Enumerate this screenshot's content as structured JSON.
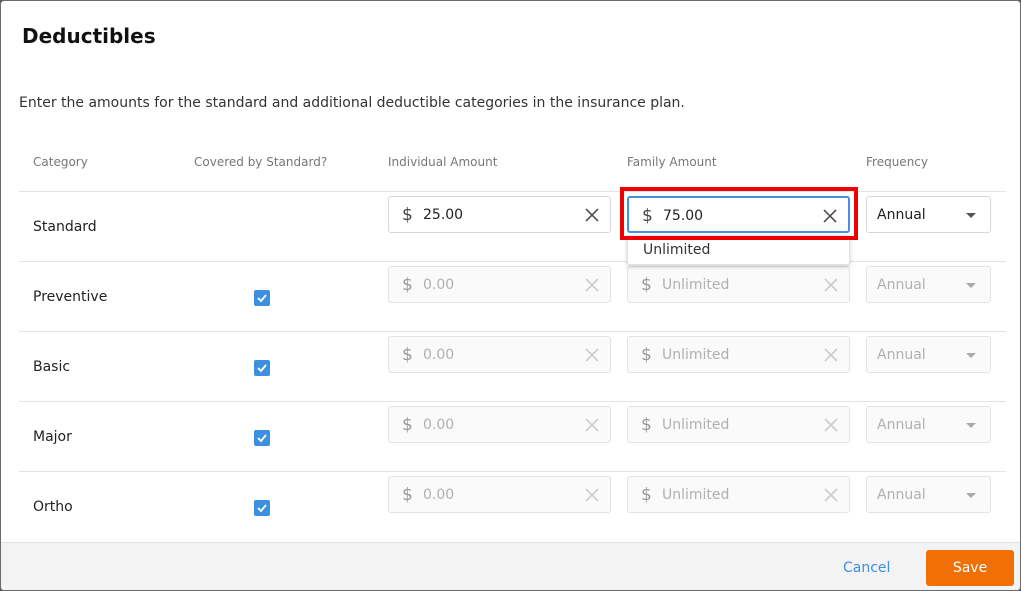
{
  "dialog": {
    "title": "Deductibles",
    "description": "Enter the amounts for the standard and additional deductible categories in the insurance plan."
  },
  "columns": {
    "category": "Category",
    "covered": "Covered by Standard?",
    "individual": "Individual Amount",
    "family": "Family Amount",
    "frequency": "Frequency"
  },
  "currency_symbol": "$",
  "rows": [
    {
      "category": "Standard",
      "covered": false,
      "individual": "25.00",
      "family": "75.00",
      "frequency": "Annual",
      "disabled": false
    },
    {
      "category": "Preventive",
      "covered": true,
      "individual": "0.00",
      "family": "Unlimited",
      "frequency": "Annual",
      "disabled": true
    },
    {
      "category": "Basic",
      "covered": true,
      "individual": "0.00",
      "family": "Unlimited",
      "frequency": "Annual",
      "disabled": true
    },
    {
      "category": "Major",
      "covered": true,
      "individual": "0.00",
      "family": "Unlimited",
      "frequency": "Annual",
      "disabled": true
    },
    {
      "category": "Ortho",
      "covered": true,
      "individual": "0.00",
      "family": "Unlimited",
      "frequency": "Annual",
      "disabled": true
    }
  ],
  "family_dropdown": {
    "option": "Unlimited"
  },
  "footer": {
    "cancel_label": "Cancel",
    "save_label": "Save"
  },
  "colors": {
    "accent": "#3d8fe0",
    "save": "#f07005",
    "highlight": "#ee0000"
  },
  "icons": {
    "currency": "dollar-icon",
    "clear": "clear-icon",
    "dropdown": "chevron-down-icon",
    "check": "check-icon"
  }
}
